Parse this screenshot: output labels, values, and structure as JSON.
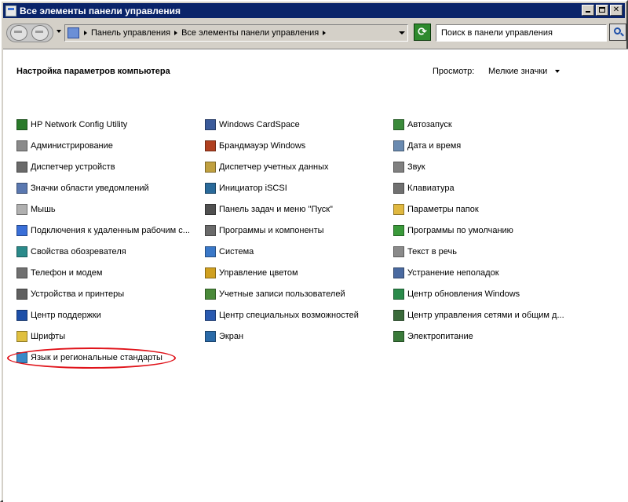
{
  "window": {
    "title": "Все элементы панели управления",
    "close_glyph": "✕"
  },
  "address": {
    "crumbs": [
      "Панель управления",
      "Все элементы панели управления"
    ]
  },
  "search": {
    "placeholder": "Поиск в панели управления"
  },
  "refresh_glyph": "⟳",
  "content": {
    "heading": "Настройка параметров компьютера",
    "view_label": "Просмотр:",
    "view_value": "Мелкие значки"
  },
  "columns": [
    [
      {
        "label": "HP Network Config Utility",
        "icon": "network-config-icon",
        "color": "#2a7a2a"
      },
      {
        "label": "Администрирование",
        "icon": "admin-tools-icon",
        "color": "#8a8a8a"
      },
      {
        "label": "Диспетчер устройств",
        "icon": "device-manager-icon",
        "color": "#6a6a6a"
      },
      {
        "label": "Значки области уведомлений",
        "icon": "notification-icons-icon",
        "color": "#5a78b0"
      },
      {
        "label": "Мышь",
        "icon": "mouse-icon",
        "color": "#b0b0b0"
      },
      {
        "label": "Подключения к удаленным рабочим с...",
        "icon": "remote-desktop-icon",
        "color": "#3a6fd8"
      },
      {
        "label": "Свойства обозревателя",
        "icon": "internet-options-icon",
        "color": "#2a8a8a"
      },
      {
        "label": "Телефон и модем",
        "icon": "phone-modem-icon",
        "color": "#707070"
      },
      {
        "label": "Устройства и принтеры",
        "icon": "devices-printers-icon",
        "color": "#606060"
      },
      {
        "label": "Центр поддержки",
        "icon": "action-center-icon",
        "color": "#1d4fa8"
      },
      {
        "label": "Шрифты",
        "icon": "fonts-icon",
        "color": "#e0c040"
      },
      {
        "label": "Язык и региональные стандарты",
        "icon": "region-language-icon",
        "color": "#3a8ac8"
      }
    ],
    [
      {
        "label": "Windows CardSpace",
        "icon": "cardspace-icon",
        "color": "#3a5a9a"
      },
      {
        "label": "Брандмауэр Windows",
        "icon": "firewall-icon",
        "color": "#b04020"
      },
      {
        "label": "Диспетчер учетных данных",
        "icon": "credential-manager-icon",
        "color": "#c0a040"
      },
      {
        "label": "Инициатор iSCSI",
        "icon": "iscsi-icon",
        "color": "#2a6a9a"
      },
      {
        "label": "Панель задач и меню \"Пуск\"",
        "icon": "taskbar-start-icon",
        "color": "#505050"
      },
      {
        "label": "Программы и компоненты",
        "icon": "programs-features-icon",
        "color": "#6a6a6a"
      },
      {
        "label": "Система",
        "icon": "system-icon",
        "color": "#3a78c8"
      },
      {
        "label": "Управление цветом",
        "icon": "color-management-icon",
        "color": "#d0a020"
      },
      {
        "label": "Учетные записи пользователей",
        "icon": "user-accounts-icon",
        "color": "#4a8a3a"
      },
      {
        "label": "Центр специальных возможностей",
        "icon": "ease-of-access-icon",
        "color": "#2a5ab0"
      },
      {
        "label": "Экран",
        "icon": "display-icon",
        "color": "#2a6aa8"
      }
    ],
    [
      {
        "label": "Автозапуск",
        "icon": "autoplay-icon",
        "color": "#3a8a3a"
      },
      {
        "label": "Дата и время",
        "icon": "date-time-icon",
        "color": "#6a8ab0"
      },
      {
        "label": "Звук",
        "icon": "sound-icon",
        "color": "#808080"
      },
      {
        "label": "Клавиатура",
        "icon": "keyboard-icon",
        "color": "#707070"
      },
      {
        "label": "Параметры папок",
        "icon": "folder-options-icon",
        "color": "#e0b840"
      },
      {
        "label": "Программы по умолчанию",
        "icon": "default-programs-icon",
        "color": "#3a9a3a"
      },
      {
        "label": "Текст в речь",
        "icon": "text-to-speech-icon",
        "color": "#8a8a8a"
      },
      {
        "label": "Устранение неполадок",
        "icon": "troubleshooting-icon",
        "color": "#4a6aa0"
      },
      {
        "label": "Центр обновления Windows",
        "icon": "windows-update-icon",
        "color": "#2a8a4a"
      },
      {
        "label": "Центр управления сетями и общим д...",
        "icon": "network-sharing-icon",
        "color": "#3a6a3a"
      },
      {
        "label": "Электропитание",
        "icon": "power-options-icon",
        "color": "#3a7a3a"
      }
    ]
  ]
}
